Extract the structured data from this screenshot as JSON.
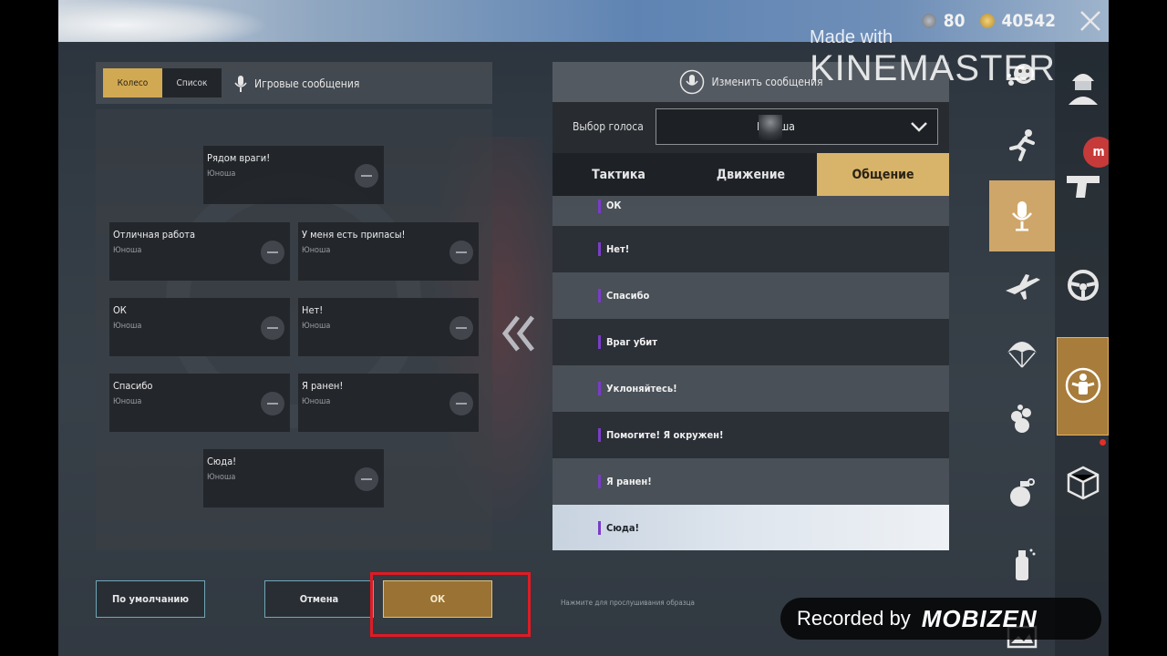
{
  "currency": {
    "silver": "80",
    "gold": "40542"
  },
  "watermarks": {
    "kine_small": "Made with",
    "kine_big": "KINEMASTER",
    "recorded_by": "Recorded by",
    "mobizen": "MOBIZEN"
  },
  "left_panel": {
    "seg_wheel": "Колесо",
    "seg_list": "Список",
    "title": "Игровые сообщения",
    "slots": [
      {
        "title": "Рядом враги!",
        "voice": "Юноша"
      },
      {
        "title": "Отличная работа",
        "voice": "Юноша"
      },
      {
        "title": "У меня есть припасы!",
        "voice": "Юноша"
      },
      {
        "title": "ОК",
        "voice": "Юноша"
      },
      {
        "title": "Нет!",
        "voice": "Юноша"
      },
      {
        "title": "Спасибо",
        "voice": "Юноша"
      },
      {
        "title": "Я ранен!",
        "voice": "Юноша"
      },
      {
        "title": "Сюда!",
        "voice": "Юноша"
      }
    ]
  },
  "right_panel": {
    "header": "Изменить сообщения",
    "voice_label": "Выбор голоса",
    "voice_value": "Юноша",
    "tabs": [
      "Тактика",
      "Движение",
      "Общение"
    ],
    "messages": [
      "ОК",
      "Нет!",
      "Спасибо",
      "Враг убит",
      "Уклоняйтесь!",
      "Помогите! Я окружен!",
      "Я ранен!",
      "Сюда!"
    ]
  },
  "buttons": {
    "default": "По умолчанию",
    "cancel": "Отмена",
    "ok": "ОК"
  },
  "hint": "Нажмите для прослушивания образца",
  "sidebar_badge": "m",
  "colors": {
    "gold": "#d8b36a",
    "accent_purple": "#7a3cc8",
    "highlight_red": "#e01b24",
    "teal_border": "#6fa7b6"
  }
}
